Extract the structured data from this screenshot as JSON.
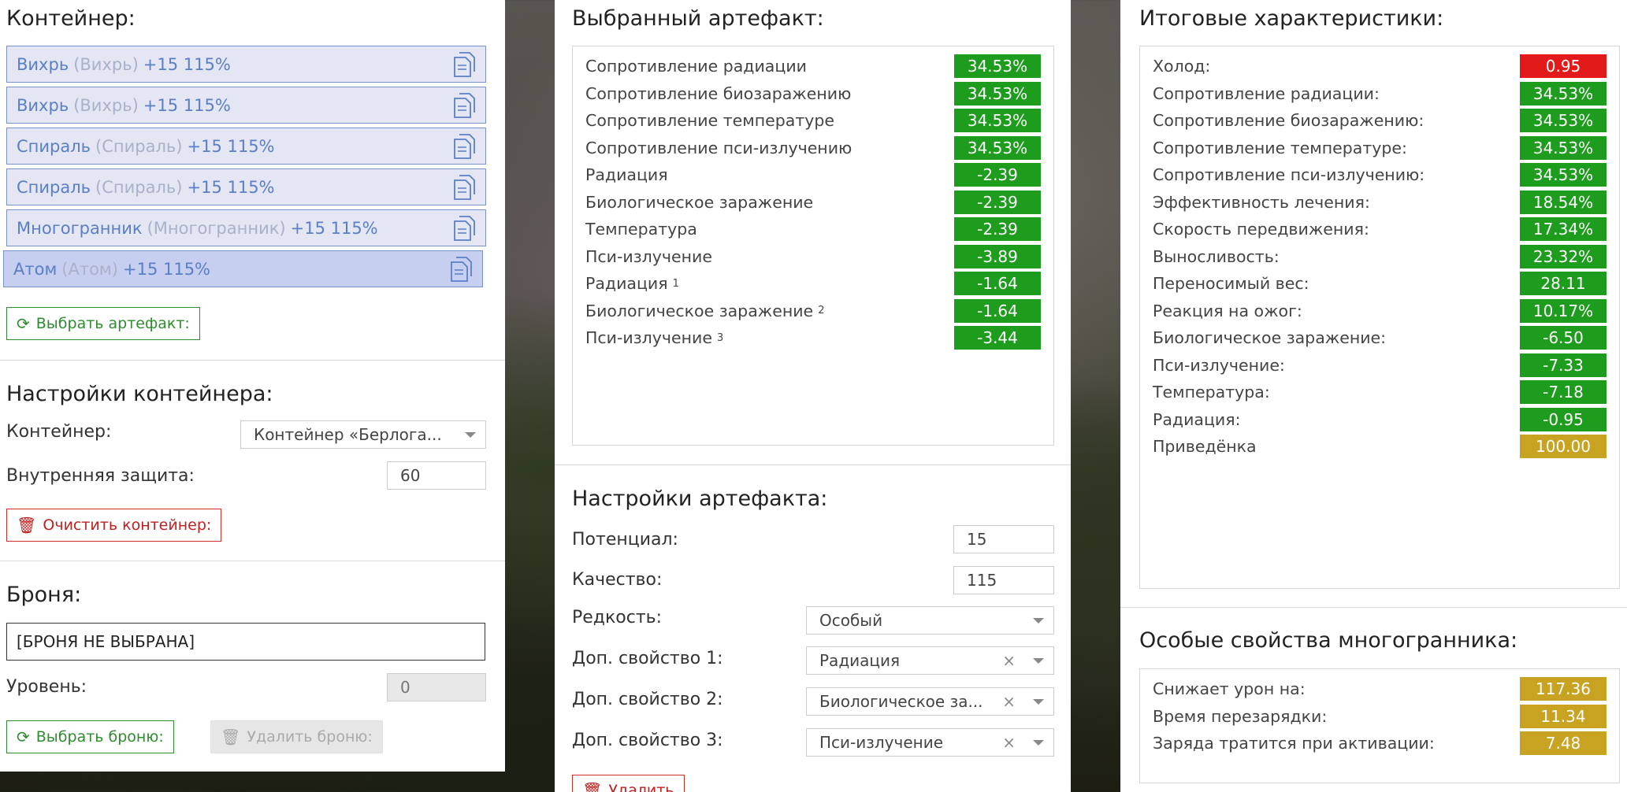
{
  "container": {
    "title": "Контейнер:",
    "slots": [
      {
        "name": "Вихрь",
        "alias": "(Вихрь)",
        "bonus": "+15 115%"
      },
      {
        "name": "Вихрь",
        "alias": "(Вихрь)",
        "bonus": "+15 115%"
      },
      {
        "name": "Спираль",
        "alias": "(Спираль)",
        "bonus": "+15 115%"
      },
      {
        "name": "Спираль",
        "alias": "(Спираль)",
        "bonus": "+15 115%"
      },
      {
        "name": "Многогранник",
        "alias": "(Многогранник)",
        "bonus": "+15 115%"
      },
      {
        "name": "Атом",
        "alias": "(Атом)",
        "bonus": "+15 115%"
      }
    ],
    "choose_artifact_label": "Выбрать артефакт:"
  },
  "container_settings": {
    "title": "Настройки контейнера:",
    "container_label": "Контейнер:",
    "container_value": "Контейнер «Берлога...",
    "inner_protection_label": "Внутренняя защита:",
    "inner_protection_value": "60",
    "clear_label": "Очистить контейнер:"
  },
  "armor": {
    "title": "Броня:",
    "value": "[БРОНЯ НЕ ВЫБРАНА]",
    "level_label": "Уровень:",
    "level_value": "0",
    "choose_label": "Выбрать броню:",
    "delete_label": "Удалить броню:"
  },
  "selected_artifact": {
    "title": "Выбранный артефакт:",
    "stats": [
      {
        "label": "Сопротивление радиации",
        "sup": "",
        "value": "34.53%",
        "color": "#1e9c1e"
      },
      {
        "label": "Сопротивление биозаражению",
        "sup": "",
        "value": "34.53%",
        "color": "#1e9c1e"
      },
      {
        "label": "Сопротивление температуре",
        "sup": "",
        "value": "34.53%",
        "color": "#1e9c1e"
      },
      {
        "label": "Сопротивление пси-излучению",
        "sup": "",
        "value": "34.53%",
        "color": "#1e9c1e"
      },
      {
        "label": "Радиация",
        "sup": "",
        "value": "-2.39",
        "color": "#1e9c1e"
      },
      {
        "label": "Биологическое заражение",
        "sup": "",
        "value": "-2.39",
        "color": "#1e9c1e"
      },
      {
        "label": "Температура",
        "sup": "",
        "value": "-2.39",
        "color": "#1e9c1e"
      },
      {
        "label": "Пси-излучение",
        "sup": "",
        "value": "-3.89",
        "color": "#1e9c1e"
      },
      {
        "label": "Радиация",
        "sup": "1",
        "value": "-1.64",
        "color": "#1e9c1e"
      },
      {
        "label": "Биологическое заражение",
        "sup": "2",
        "value": "-1.64",
        "color": "#1e9c1e"
      },
      {
        "label": "Пси-излучение",
        "sup": "3",
        "value": "-3.44",
        "color": "#1e9c1e"
      }
    ]
  },
  "artifact_settings": {
    "title": "Настройки артефакта:",
    "potential_label": "Потенциал:",
    "potential_value": "15",
    "quality_label": "Качество:",
    "quality_value": "115",
    "rarity_label": "Редкость:",
    "rarity_value": "Особый",
    "extra1_label": "Доп. свойство 1:",
    "extra1_value": "Радиация",
    "extra2_label": "Доп. свойство 2:",
    "extra2_value": "Биологическое за...",
    "extra3_label": "Доп. свойство 3:",
    "extra3_value": "Пси-излучение",
    "delete_label": "Удалить"
  },
  "totals": {
    "title": "Итоговые характеристики:",
    "stats": [
      {
        "label": "Холод:",
        "value": "0.95",
        "color": "#e21a1a"
      },
      {
        "label": "Сопротивление радиации:",
        "value": "34.53%",
        "color": "#1e9c1e"
      },
      {
        "label": "Сопротивление биозаражению:",
        "value": "34.53%",
        "color": "#1e9c1e"
      },
      {
        "label": "Сопротивление температуре:",
        "value": "34.53%",
        "color": "#1e9c1e"
      },
      {
        "label": "Сопротивление пси-излучению:",
        "value": "34.53%",
        "color": "#1e9c1e"
      },
      {
        "label": "Эффективность лечения:",
        "value": "18.54%",
        "color": "#1e9c1e"
      },
      {
        "label": "Скорость передвижения:",
        "value": "17.34%",
        "color": "#1e9c1e"
      },
      {
        "label": "Выносливость:",
        "value": "23.32%",
        "color": "#1e9c1e"
      },
      {
        "label": "Переносимый вес:",
        "value": "28.11",
        "color": "#1e9c1e"
      },
      {
        "label": "Реакция на ожог:",
        "value": "10.17%",
        "color": "#1e9c1e"
      },
      {
        "label": "Биологическое заражение:",
        "value": "-6.50",
        "color": "#1e9c1e"
      },
      {
        "label": "Пси-излучение:",
        "value": "-7.33",
        "color": "#1e9c1e"
      },
      {
        "label": "Температура:",
        "value": "-7.18",
        "color": "#1e9c1e"
      },
      {
        "label": "Радиация:",
        "value": "-0.95",
        "color": "#1e9c1e"
      },
      {
        "label": "Приведёнка",
        "value": "100.00",
        "color": "#c8a322"
      }
    ]
  },
  "polyhedron": {
    "title": "Особые свойства многогранника:",
    "stats": [
      {
        "label": "Снижает урон на:",
        "value": "117.36",
        "color": "#c8a322"
      },
      {
        "label": "Время перезарядки:",
        "value": "11.34",
        "color": "#c8a322"
      },
      {
        "label": "Заряда тратится при активации:",
        "value": "7.48",
        "color": "#c8a322"
      }
    ]
  }
}
